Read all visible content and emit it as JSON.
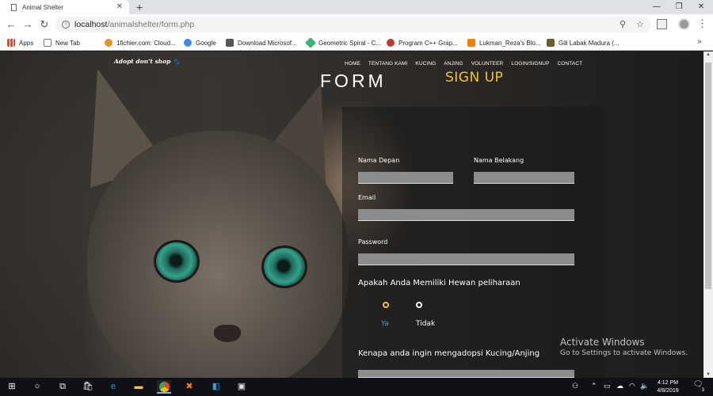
{
  "browser": {
    "tab_title": "Animal Shelter",
    "new_tab_label": "+",
    "url_host": "localhost",
    "url_path": "/animalshelter/form.php",
    "bookmarks": [
      {
        "label": "Apps",
        "color": "#ea4335"
      },
      {
        "label": "New Tab",
        "color": "#ffffff"
      },
      {
        "label": "1fichier.com: Cloud...",
        "color": "#e8912d"
      },
      {
        "label": "Google",
        "color": "#4285f4"
      },
      {
        "label": "Download Microsof...",
        "color": "#555555"
      },
      {
        "label": "Geometric Spiral - C...",
        "color": "#3fb37f"
      },
      {
        "label": "Program C++ Grap...",
        "color": "#c0392b"
      },
      {
        "label": "Lukman_Reza's Blo...",
        "color": "#f57d00"
      },
      {
        "label": "Gili Labak Madura (...",
        "color": "#6b5b2e"
      }
    ],
    "more_bookmarks": "»"
  },
  "site": {
    "logo_text": "Adopt don't shop",
    "nav": [
      "HOME",
      "TENTANG KAMI",
      "KUCING",
      "ANJING",
      "VOLUNTEER",
      "LOGIN/SIGNUP",
      "CONTACT"
    ],
    "page_title": "FORM"
  },
  "form": {
    "title": "SIGN UP",
    "first_name_label": "Nama Depan",
    "last_name_label": "Nama Belakang",
    "email_label": "Email",
    "password_label": "Password",
    "question_pet": "Apakah Anda Memiliki Hewan peliharaan",
    "option_yes": "Ya",
    "option_no": "Tidak",
    "question_reason": "Kenapa anda ingin mengadopsi Kucing/Anjing",
    "accent_color": "#f1c232",
    "selected_option": "Ya"
  },
  "watermark": {
    "line1": "Activate Windows",
    "line2": "Go to Settings to activate Windows."
  },
  "taskbar": {
    "time": "4:12 PM",
    "date": "4/8/2019",
    "notification_count": "3"
  }
}
